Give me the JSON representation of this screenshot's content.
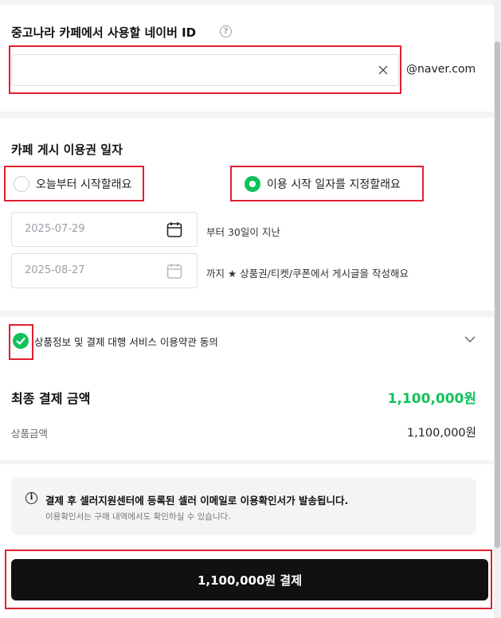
{
  "naver_id": {
    "title": "중고나라 카페에서 사용할 네이버 ID",
    "value": "",
    "suffix": "@naver.com",
    "help_icon": "question-circle-icon",
    "clear_icon": "close-icon"
  },
  "period": {
    "title": "카페 게시 이용권 일자",
    "options": [
      {
        "label": "오늘부터 시작할래요",
        "selected": false
      },
      {
        "label": "이용 시작 일자를 지정할래요",
        "selected": true
      }
    ],
    "start_date": "2025-07-29",
    "start_suffix": "부터 30일이 지난",
    "end_date": "2025-08-27",
    "end_suffix": "까지 ★ 상품권/티켓/쿠폰에서 게시글을 작성해요"
  },
  "agreement": {
    "label": "상품정보 및 결제 대행 서비스 이용약관 동의",
    "checked": true
  },
  "payment": {
    "total_label": "최종 결제 금액",
    "total_amount": "1,100,000원",
    "price_label": "상품금액",
    "price_amount": "1,100,000원"
  },
  "notice": {
    "main": "결제 후 셀러지원센터에 등록된 셀러 이메일로 이용확인서가 발송됩니다.",
    "sub": "이용확인서는 구매 내역에서도 확인하실 수 있습니다."
  },
  "pay_button": {
    "label": "1,100,000원 결제"
  },
  "colors": {
    "accent_green": "#12c15c",
    "highlight_red": "#e0202e",
    "button_black": "#111111"
  }
}
